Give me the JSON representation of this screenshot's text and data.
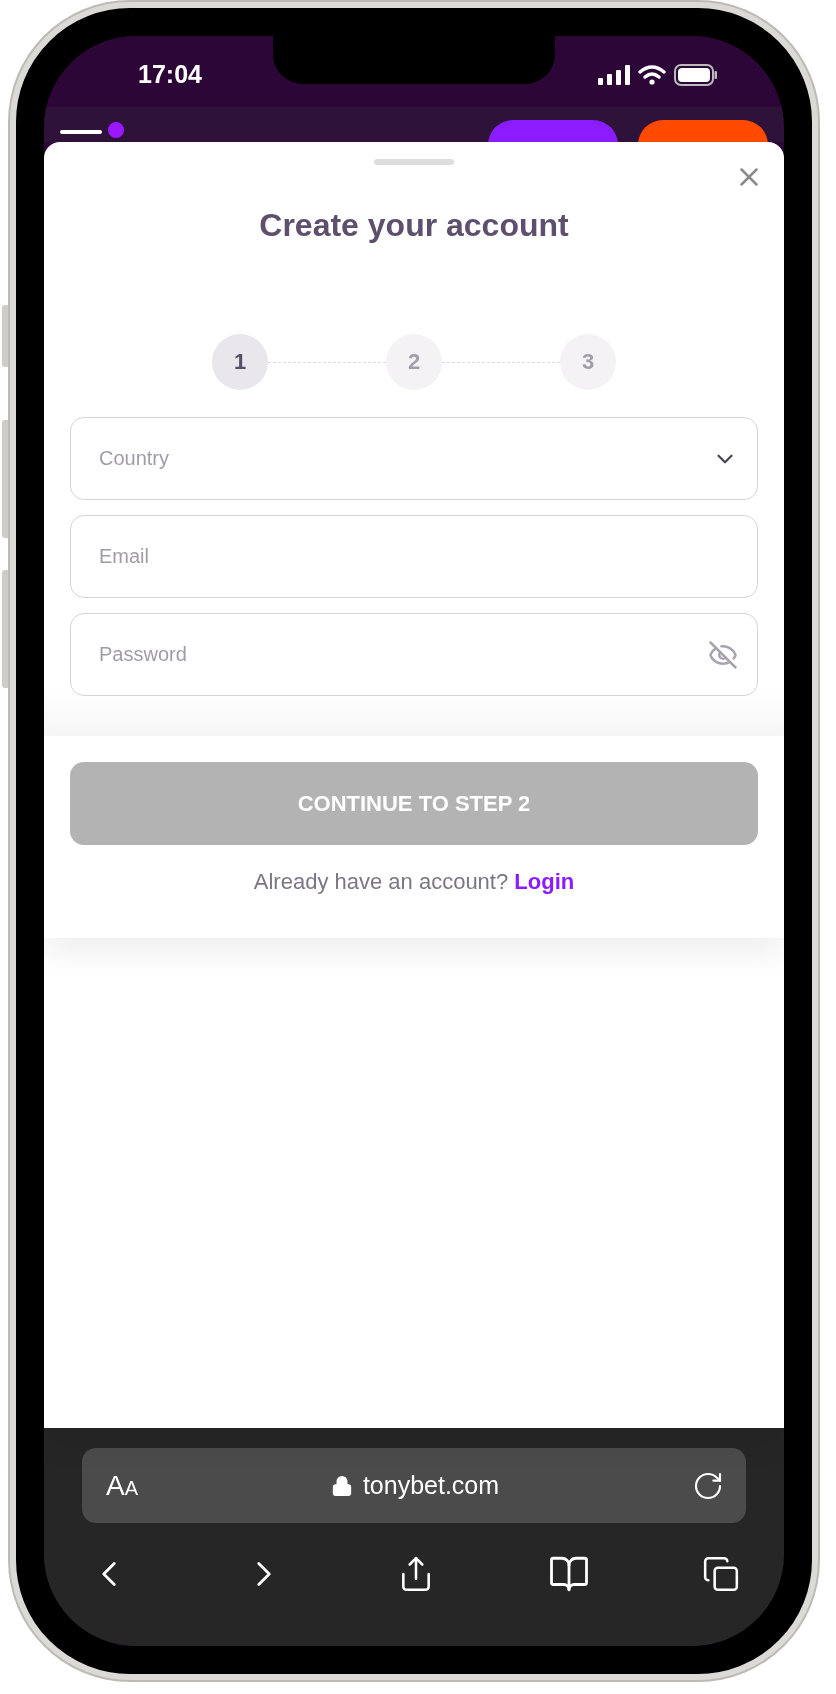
{
  "status_bar": {
    "time": "17:04"
  },
  "header": {
    "buttons": [
      {
        "kind": "login"
      },
      {
        "kind": "signup"
      }
    ]
  },
  "modal": {
    "title": "Create your account",
    "steps": [
      {
        "label": "1",
        "active": true
      },
      {
        "label": "2",
        "active": false
      },
      {
        "label": "3",
        "active": false
      }
    ],
    "fields": [
      {
        "kind": "select",
        "placeholder": "Country"
      },
      {
        "kind": "text",
        "placeholder": "Email"
      },
      {
        "kind": "password",
        "placeholder": "Password"
      }
    ],
    "continue_button": {
      "label": "CONTINUE TO STEP 2",
      "disabled": true
    },
    "login_prompt": {
      "text": "Already have an account?",
      "link": "Login"
    }
  },
  "browser": {
    "text_size_button": "AA",
    "url": "tonybet.com"
  }
}
